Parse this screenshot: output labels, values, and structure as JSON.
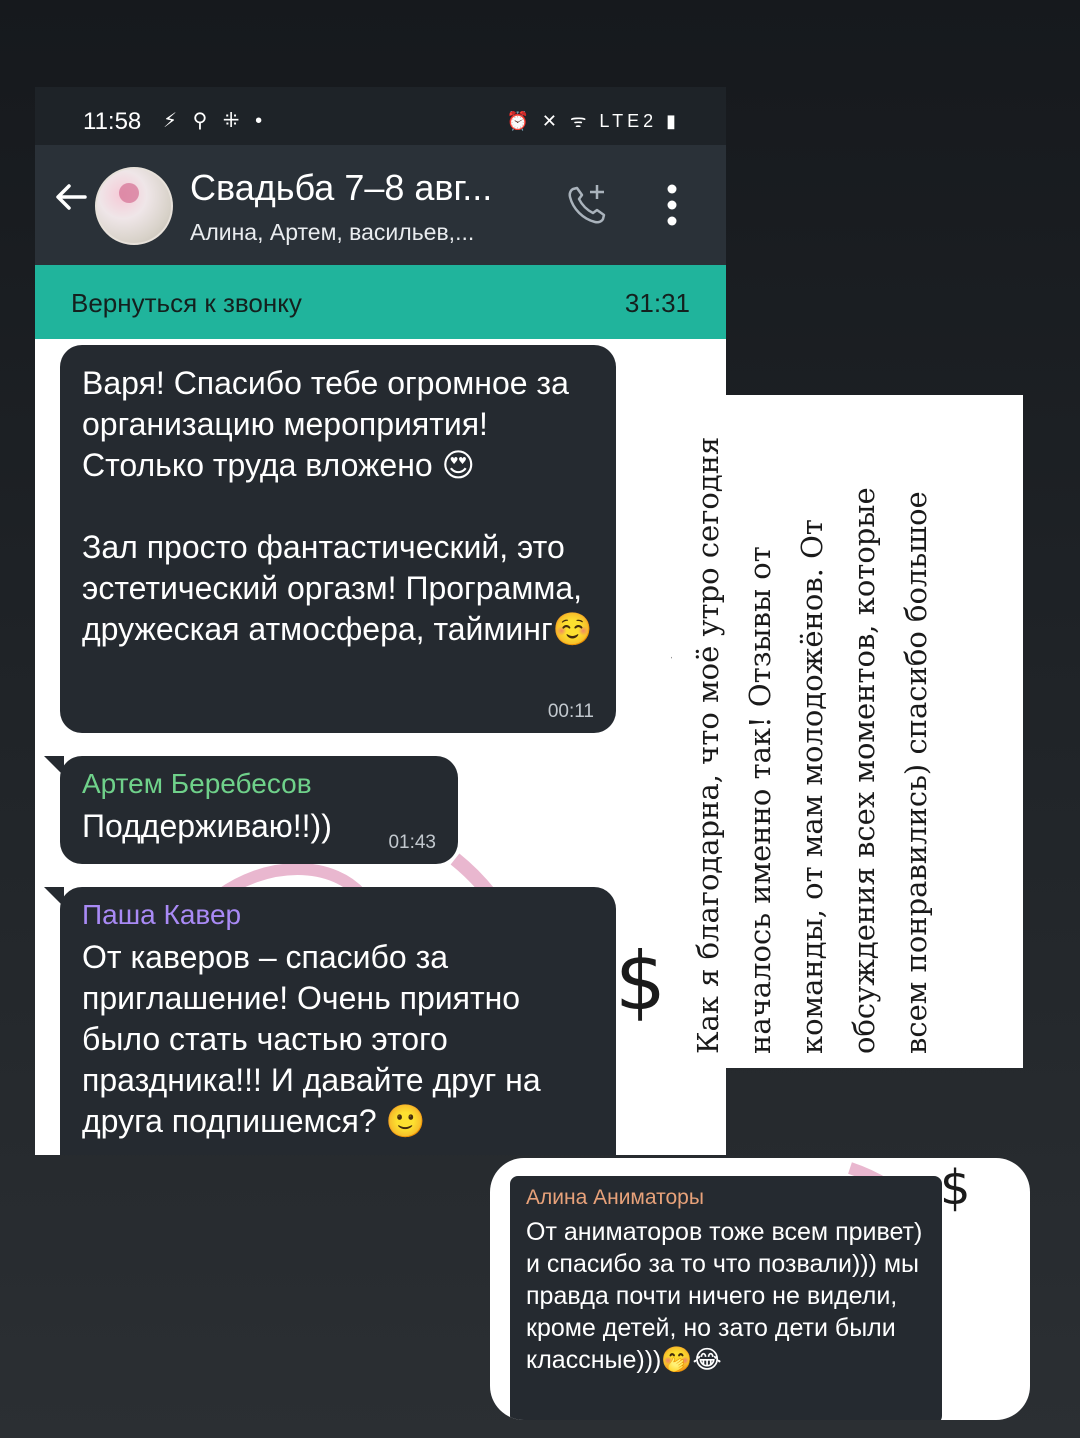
{
  "status_bar": {
    "time": "11:58",
    "left_icons": "⚡ ⚲ ⁜ •",
    "right_icons": "⏰ ✕ ᯤ LTE2 ▮"
  },
  "header": {
    "title": "Свадьба 7–8 авг...",
    "members": "Алина, Артем, васильев,..."
  },
  "call_banner": {
    "label": "Вернуться к звонку",
    "timer": "31:31"
  },
  "messages": [
    {
      "text": "Варя! Спасибо тебе огромное за организацию мероприятия! Столько труда вложено 😍\n\nЗал просто фантастический, это эстетический оргазм! Программа, дружеская атмосфера, тайминг☺️",
      "time": "00:11"
    },
    {
      "sender": "Артем Беребесов",
      "sender_color": "#6fd18a",
      "text": "Поддерживаю!!))",
      "time": "01:43"
    },
    {
      "sender": "Паша Кавер",
      "sender_color": "#a98af5",
      "text": "От каверов – спасибо за приглашение! Очень приятно было стать частью этого праздника!!! И давайте друг на друга подпишемся? 🙂"
    },
    {
      "sender": "Алина Аниматоры",
      "sender_color": "#e8a27a",
      "text": "От аниматоров тоже всем привет) и спасибо за то что позвали))) мы правда почти ничего не видели, кроме детей, но зато дети были классные)))🤭😂"
    }
  ],
  "caption": "Как я благодарна, что моё утро сегодня началось именно так! Отзывы от команды, от мам молодожёнов. От обсуждения всех моментов, которые всем понравились) спасибо большое",
  "colors": {
    "bubble": "#252a30",
    "call_banner": "#20b49c",
    "app_bar": "#2a3138"
  }
}
